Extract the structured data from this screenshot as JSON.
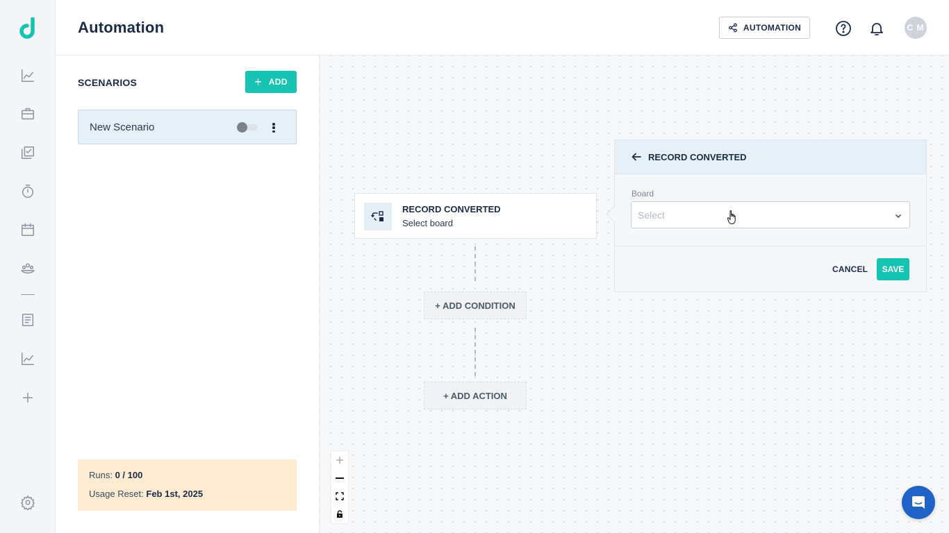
{
  "header": {
    "title": "Automation",
    "automation_button": "AUTOMATION",
    "avatar_initials": "C M"
  },
  "sidebar": {
    "icons": [
      "logo-icon",
      "chart-icon",
      "briefcase-icon",
      "checklist-icon",
      "timer-icon",
      "calendar-icon",
      "team-icon",
      "document-icon",
      "analytics-icon",
      "plus-icon",
      "gear-icon"
    ]
  },
  "scenarios": {
    "title": "SCENARIOS",
    "add_label": "ADD",
    "items": [
      {
        "name": "New Scenario",
        "enabled": false
      }
    ],
    "usage": {
      "runs_label": "Runs:",
      "runs_value": "0 / 100",
      "reset_label": "Usage Reset:",
      "reset_value": "Feb 1st, 2025"
    }
  },
  "canvas": {
    "trigger": {
      "title": "RECORD CONVERTED",
      "subtitle": "Select board"
    },
    "add_condition": "+ ADD CONDITION",
    "add_action": "+ ADD ACTION"
  },
  "config_panel": {
    "title": "RECORD CONVERTED",
    "board_label": "Board",
    "board_placeholder": "Select",
    "cancel_label": "CANCEL",
    "save_label": "SAVE"
  },
  "colors": {
    "accent": "#17c3b2",
    "primary_text": "#1a2b4a",
    "selected_bg": "#e5f0f8",
    "usage_bg": "#fdecd2",
    "chat_button": "#1f63c6"
  }
}
